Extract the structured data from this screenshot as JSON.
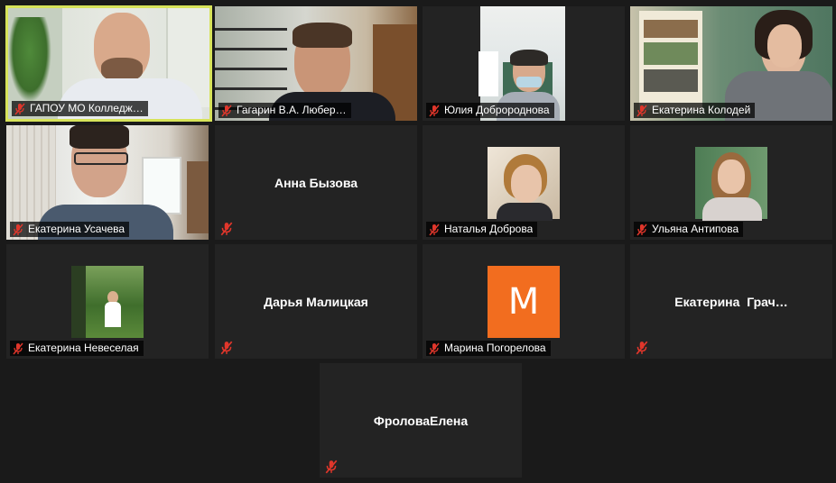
{
  "colors": {
    "background": "#1a1a1a",
    "tile": "#232323",
    "active_border": "#d7e35a",
    "mic_muted": "#e0362b",
    "avatar_orange": "#f26d1f"
  },
  "participants": [
    {
      "name": "ГАПОУ МО Колледж…",
      "video": true,
      "active": true
    },
    {
      "name": "Гагарин В.А. Любер…",
      "video": true
    },
    {
      "name": "Юлия Добророднова",
      "video": true
    },
    {
      "name": "Екатерина Колодей",
      "video": true
    },
    {
      "name": "Екатерина Усачева",
      "video": true
    },
    {
      "name": "Анна Бызова",
      "video": false
    },
    {
      "name": "Наталья Доброва",
      "video": false,
      "profile_photo": true
    },
    {
      "name": "Ульяна Антипова",
      "video": false,
      "profile_photo": true
    },
    {
      "name": "Екатерина Невеселая",
      "video": false,
      "profile_photo": true
    },
    {
      "name": "Дарья Малицкая",
      "video": false
    },
    {
      "name": "Марина Погорелова",
      "video": false,
      "avatar_letter": "M"
    },
    {
      "name": "Екатерина  Грач…",
      "video": false
    },
    {
      "name": "ФроловаЕлена",
      "video": false
    }
  ],
  "icons": {
    "mic": "mic-muted-icon"
  }
}
